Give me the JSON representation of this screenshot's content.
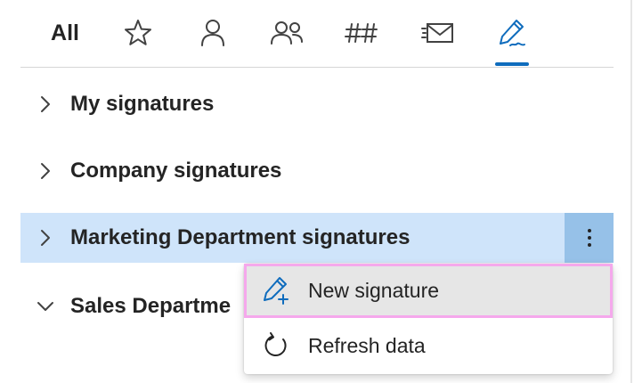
{
  "tabs": {
    "all_label": "All",
    "icons": [
      "star-icon",
      "person-icon",
      "people-icon",
      "hashtag-icon",
      "envelope-icon",
      "signature-pen-icon"
    ],
    "active_tab": "signature-pen-icon"
  },
  "groups": [
    {
      "label": "My signatures",
      "expanded": false
    },
    {
      "label": "Company signatures",
      "expanded": false
    },
    {
      "label": "Marketing Department signatures",
      "expanded": false,
      "selected": true
    },
    {
      "label": "Sales Departme",
      "expanded": true
    }
  ],
  "context_menu": {
    "items": [
      {
        "label": "New signature",
        "icon": "pen-add-icon"
      },
      {
        "label": "Refresh data",
        "icon": "refresh-icon"
      }
    ]
  },
  "colors": {
    "accent": "#0f6cbd",
    "selected_row": "#cfe4fa",
    "more_button": "#96c1e8",
    "menu_hover": "#e6e6e6",
    "highlight": "#f5a8ec"
  }
}
